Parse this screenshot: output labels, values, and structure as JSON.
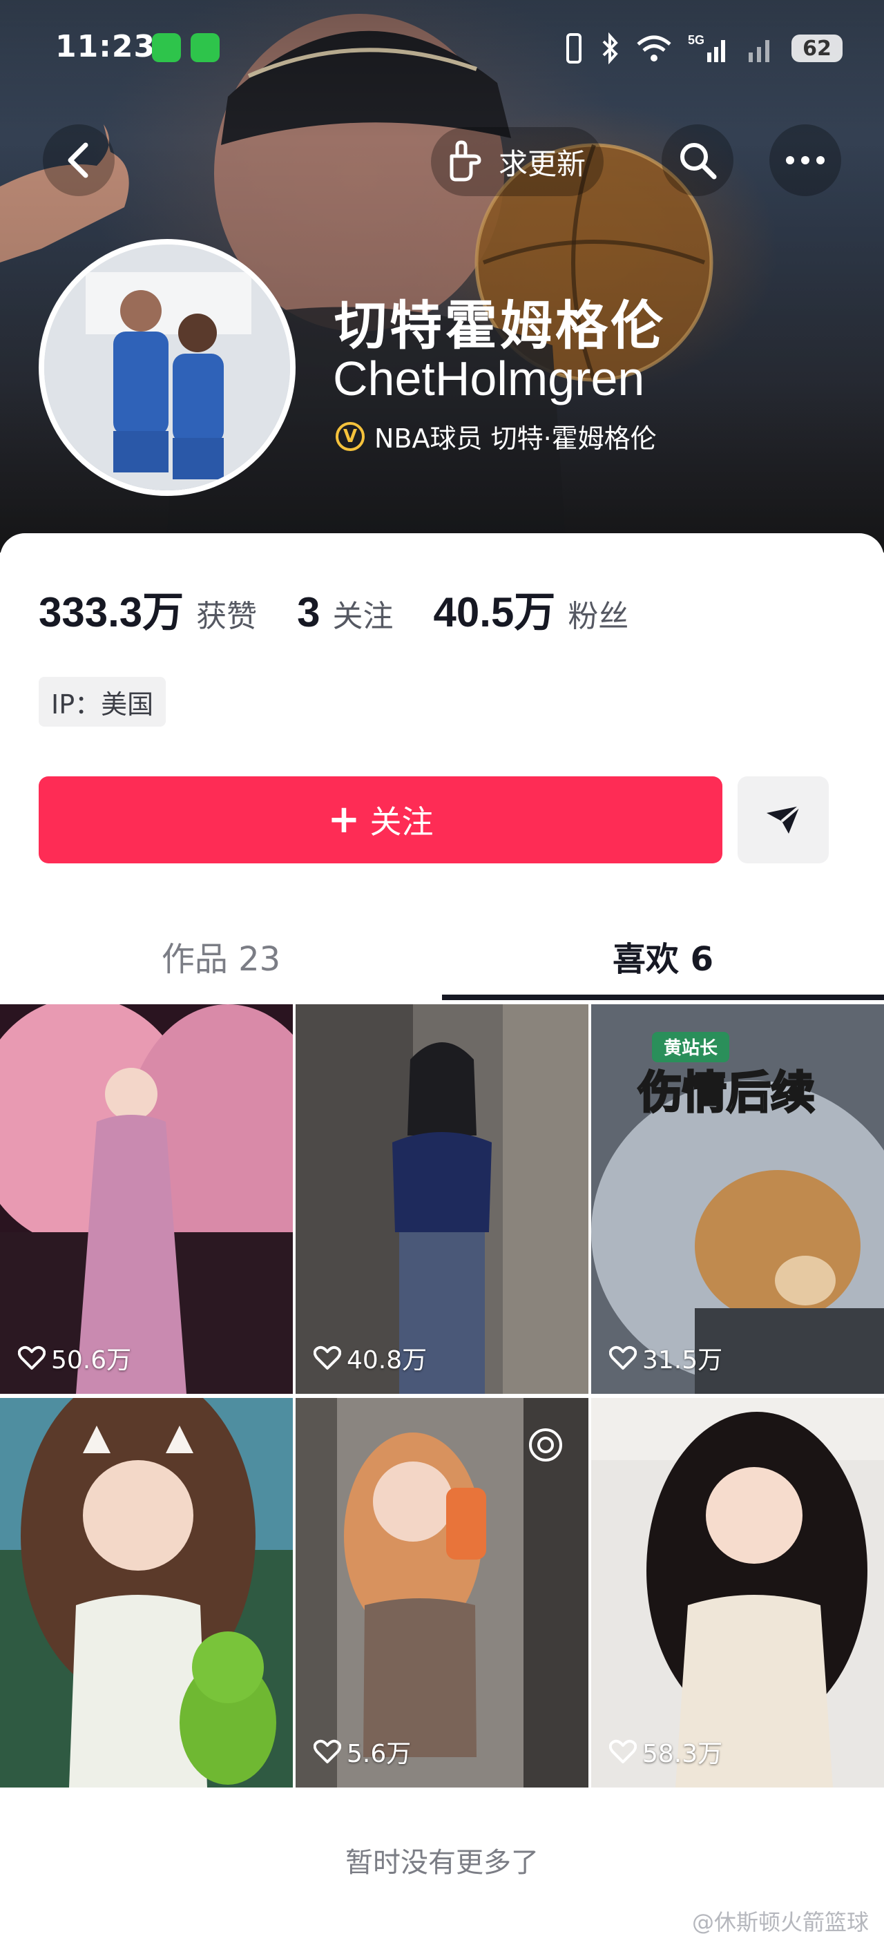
{
  "status_bar": {
    "time": "11:23",
    "battery": "62"
  },
  "nav": {
    "update_label": "求更新"
  },
  "profile": {
    "display_name": "切特霍姆格伦",
    "handle": "ChetHolmgren",
    "verification": "NBA球员 切特·霍姆格伦",
    "stats": {
      "likes_value": "333.3万",
      "likes_label": "获赞",
      "following_value": "3",
      "following_label": "关注",
      "followers_value": "40.5万",
      "followers_label": "粉丝"
    },
    "ip": "IP：美国"
  },
  "actions": {
    "follow_label": "关注",
    "follow_color": "#fe2c55"
  },
  "tabs": [
    {
      "label": "作品 23",
      "active": false
    },
    {
      "label": "喜欢 6",
      "active": true
    }
  ],
  "grid": [
    {
      "likes": "50.6万"
    },
    {
      "likes": "40.8万"
    },
    {
      "likes": "31.5万",
      "caption_top": "黄站长",
      "caption_main": "伤情后续"
    },
    {
      "likes": ""
    },
    {
      "likes": "5.6万"
    },
    {
      "likes": "58.3万"
    }
  ],
  "footer": {
    "no_more": "暂时没有更多了",
    "watermark": "@休斯顿火箭篮球"
  }
}
